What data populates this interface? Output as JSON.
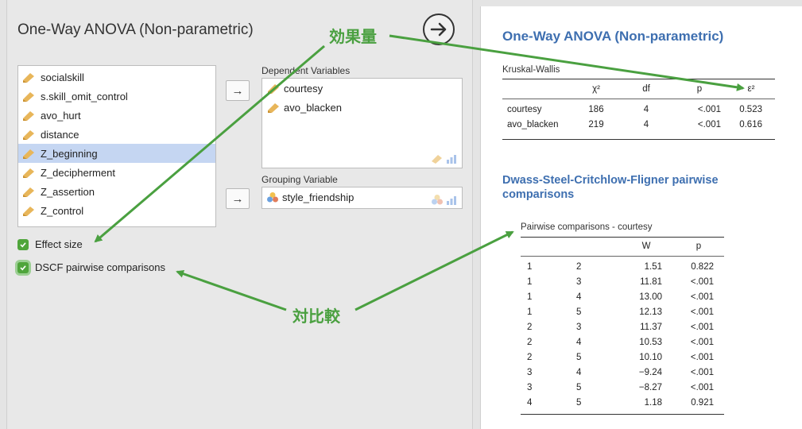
{
  "analysis": {
    "title": "One-Way ANOVA (Non-parametric)"
  },
  "variables": [
    {
      "name": "socialskill",
      "selected": false
    },
    {
      "name": "s.skill_omit_control",
      "selected": false
    },
    {
      "name": "avo_hurt",
      "selected": false
    },
    {
      "name": "distance",
      "selected": false
    },
    {
      "name": "Z_beginning",
      "selected": true
    },
    {
      "name": "Z_decipherment",
      "selected": false
    },
    {
      "name": "Z_assertion",
      "selected": false
    },
    {
      "name": "Z_control",
      "selected": false
    }
  ],
  "dependent": {
    "label": "Dependent Variables",
    "items": [
      "courtesy",
      "avo_blacken"
    ]
  },
  "grouping": {
    "label": "Grouping Variable",
    "value": "style_friendship"
  },
  "move_arrow": "→",
  "options": {
    "effect_size": {
      "label": "Effect size",
      "checked": true
    },
    "dscf": {
      "label": "DSCF pairwise comparisons",
      "checked": true
    }
  },
  "annotations": {
    "effect_size": "効果量",
    "pairwise": "対比較"
  },
  "results": {
    "title": "One-Way ANOVA (Non-parametric)",
    "kw": {
      "title": "Kruskal-Wallis",
      "headers": [
        "",
        "χ²",
        "df",
        "p",
        "ε²"
      ],
      "rows": [
        [
          "courtesy",
          "186",
          "4",
          "<.001",
          "0.523"
        ],
        [
          "avo_blacken",
          "219",
          "4",
          "<.001",
          "0.616"
        ]
      ]
    },
    "dscf_title": "Dwass-Steel-Critchlow-Fligner pairwise comparisons",
    "pairwise": {
      "title": "Pairwise comparisons - courtesy",
      "headers": [
        "",
        "",
        "W",
        "p"
      ],
      "rows": [
        [
          "1",
          "2",
          "1.51",
          "0.822"
        ],
        [
          "1",
          "3",
          "11.81",
          "<.001"
        ],
        [
          "1",
          "4",
          "13.00",
          "<.001"
        ],
        [
          "1",
          "5",
          "12.13",
          "<.001"
        ],
        [
          "2",
          "3",
          "11.37",
          "<.001"
        ],
        [
          "2",
          "4",
          "10.53",
          "<.001"
        ],
        [
          "2",
          "5",
          "10.10",
          "<.001"
        ],
        [
          "3",
          "4",
          "−9.24",
          "<.001"
        ],
        [
          "3",
          "5",
          "−8.27",
          "<.001"
        ],
        [
          "4",
          "5",
          "1.18",
          "0.921"
        ]
      ]
    }
  },
  "colors": {
    "accent_green": "#4aa040",
    "results_title": "#3e6fb0",
    "selection": "#c5d6f2",
    "nominal_pencil": "#e8b65a"
  }
}
